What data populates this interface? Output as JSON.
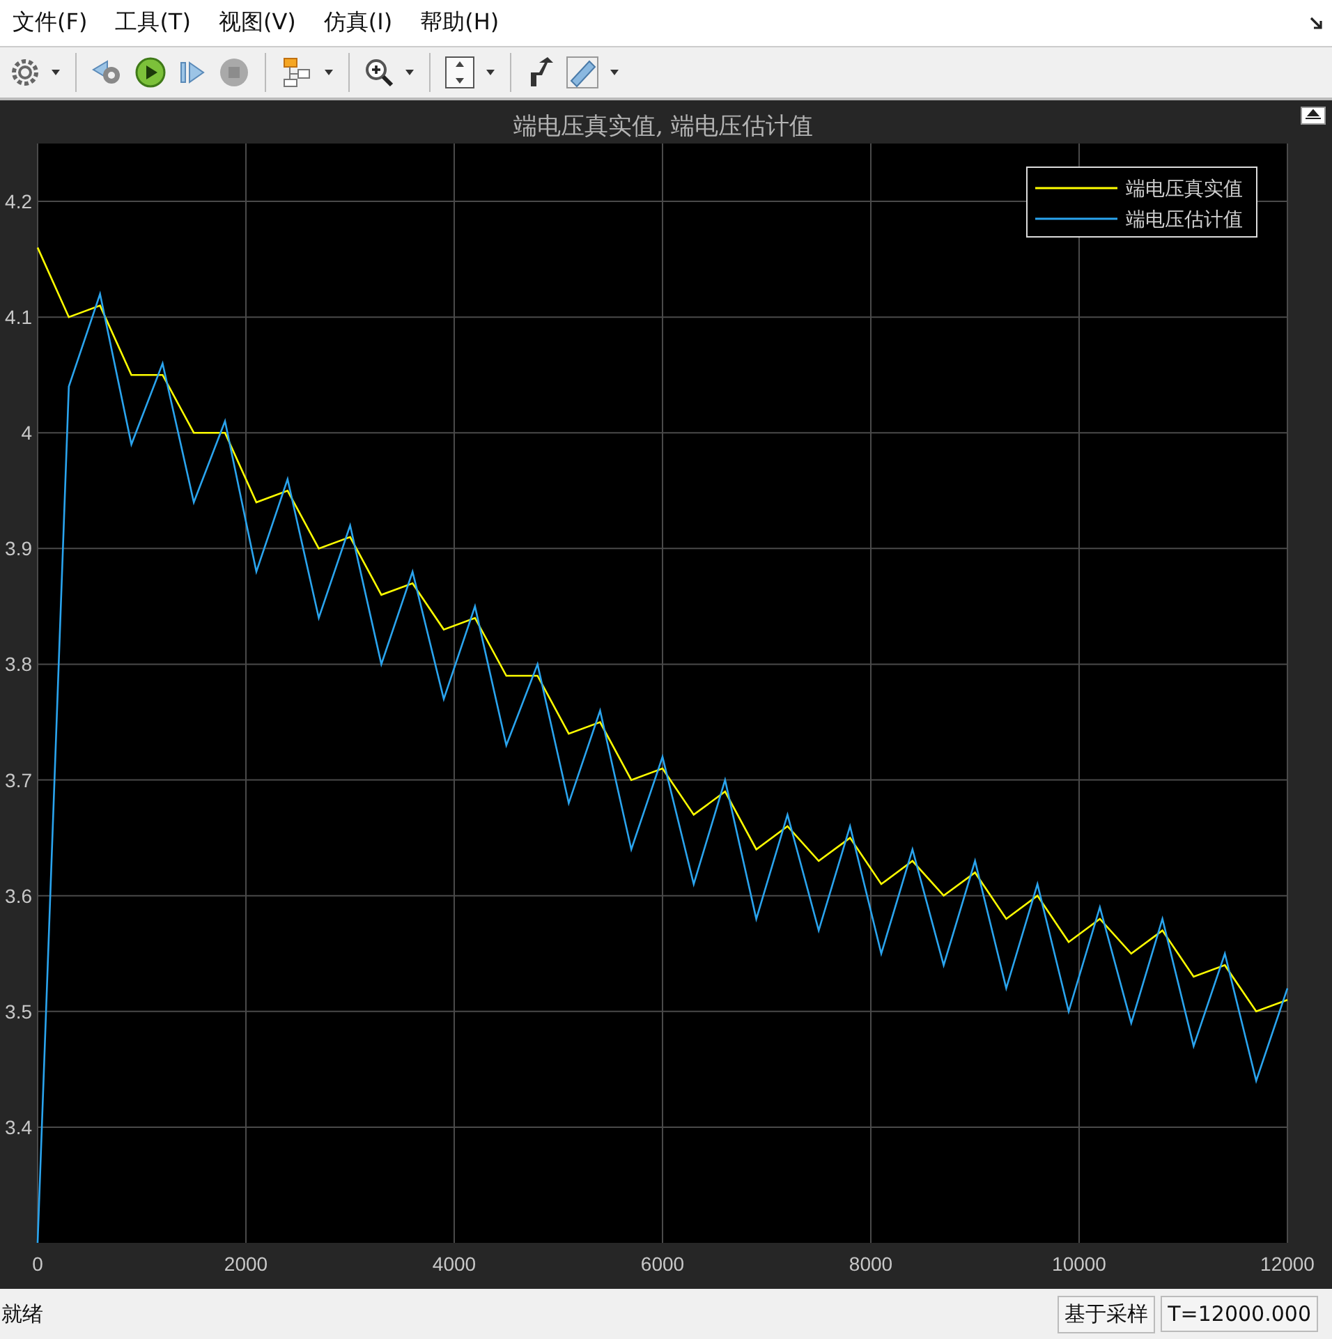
{
  "menu": [
    "文件(F)",
    "工具(T)",
    "视图(V)",
    "仿真(I)",
    "帮助(H)"
  ],
  "scope": {
    "chart_data": {
      "type": "line",
      "title": "端电压真实值, 端电压估计值",
      "xlim": [
        0,
        12000
      ],
      "ylim": [
        3.3,
        4.25
      ],
      "xticks": [
        0,
        2000,
        4000,
        6000,
        8000,
        10000,
        12000
      ],
      "yticks": [
        3.4,
        3.5,
        3.6,
        3.7,
        3.8,
        3.9,
        4,
        4.1,
        4.2
      ],
      "grid": true,
      "legend": true,
      "x": [
        0,
        300,
        600,
        900,
        1200,
        1500,
        1800,
        2100,
        2400,
        2700,
        3000,
        3300,
        3600,
        3900,
        4200,
        4500,
        4800,
        5100,
        5400,
        5700,
        6000,
        6300,
        6600,
        6900,
        7200,
        7500,
        7800,
        8100,
        8400,
        8700,
        9000,
        9300,
        9600,
        9900,
        10200,
        10500,
        10800,
        11100,
        11400,
        11700,
        12000
      ],
      "series": [
        {
          "name": "端电压真实值",
          "color": "#ffff00",
          "values": [
            4.16,
            4.1,
            4.11,
            4.05,
            4.05,
            4.0,
            4.0,
            3.94,
            3.95,
            3.9,
            3.91,
            3.86,
            3.87,
            3.83,
            3.84,
            3.79,
            3.79,
            3.74,
            3.75,
            3.7,
            3.71,
            3.67,
            3.69,
            3.64,
            3.66,
            3.63,
            3.65,
            3.61,
            3.63,
            3.6,
            3.62,
            3.58,
            3.6,
            3.56,
            3.58,
            3.55,
            3.57,
            3.53,
            3.54,
            3.5,
            3.51
          ]
        },
        {
          "name": "端电压估计值",
          "color": "#2aa4ee",
          "values": [
            3.3,
            4.04,
            4.12,
            3.99,
            4.06,
            3.94,
            4.01,
            3.88,
            3.96,
            3.84,
            3.92,
            3.8,
            3.88,
            3.77,
            3.85,
            3.73,
            3.8,
            3.68,
            3.76,
            3.64,
            3.72,
            3.61,
            3.7,
            3.58,
            3.67,
            3.57,
            3.66,
            3.55,
            3.64,
            3.54,
            3.63,
            3.52,
            3.61,
            3.5,
            3.59,
            3.49,
            3.58,
            3.47,
            3.55,
            3.44,
            3.52
          ]
        }
      ]
    }
  },
  "status_bar": {
    "message": "就绪",
    "mode": "基于采样",
    "time": "T=12000.000"
  }
}
